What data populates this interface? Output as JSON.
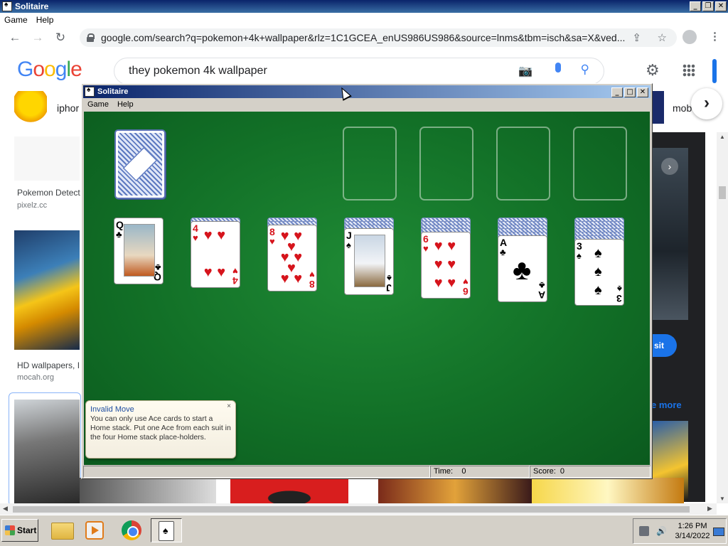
{
  "outer_window": {
    "title": "Solitaire",
    "menu": [
      "Game",
      "Help"
    ]
  },
  "browser": {
    "url": "google.com/search?q=pokemon+4k+wallpaper&rlz=1C1GCEA_enUS986US986&source=lnms&tbm=isch&sa=X&ved..."
  },
  "google": {
    "logo_letters": [
      {
        "ch": "G",
        "color": "#4285F4"
      },
      {
        "ch": "o",
        "color": "#EA4335"
      },
      {
        "ch": "o",
        "color": "#FBBC05"
      },
      {
        "ch": "g",
        "color": "#4285F4"
      },
      {
        "ch": "l",
        "color": "#34A853"
      },
      {
        "ch": "e",
        "color": "#EA4335"
      }
    ],
    "search_value": "they pokemon 4k wallpaper",
    "chips": {
      "left": "iphor",
      "right": "mob"
    },
    "results": [
      {
        "title": "Pokemon Detect",
        "source": "pixelz.cc"
      },
      {
        "title": "HD wallpapers, I",
        "source": "mocah.org"
      }
    ],
    "visit_label": "sit",
    "see_more_label": "e more"
  },
  "solitaire": {
    "title": "Solitaire",
    "menu": [
      "Game",
      "Help"
    ],
    "status": {
      "time_label": "Time:",
      "time_value": "0",
      "score_label": "Score:",
      "score_value": "0"
    },
    "tableau": [
      {
        "hidden": 0,
        "rank": "Q",
        "suit": "♣",
        "color": "black",
        "face": true
      },
      {
        "hidden": 1,
        "rank": "4",
        "suit": "♥",
        "color": "red"
      },
      {
        "hidden": 2,
        "rank": "8",
        "suit": "♥",
        "color": "red"
      },
      {
        "hidden": 3,
        "rank": "J",
        "suit": "♠",
        "color": "black",
        "face": true
      },
      {
        "hidden": 4,
        "rank": "6",
        "suit": "♥",
        "color": "red"
      },
      {
        "hidden": 5,
        "rank": "A",
        "suit": "♣",
        "color": "black"
      },
      {
        "hidden": 6,
        "rank": "3",
        "suit": "♠",
        "color": "black"
      }
    ],
    "tooltip": {
      "title": "Invalid Move",
      "body": "You can only use Ace cards to start a Home stack. Put one Ace from each suit in the four Home stack place-holders."
    }
  },
  "taskbar": {
    "start_label": "Start",
    "clock_time": "1:26 PM",
    "clock_date": "3/14/2022"
  }
}
